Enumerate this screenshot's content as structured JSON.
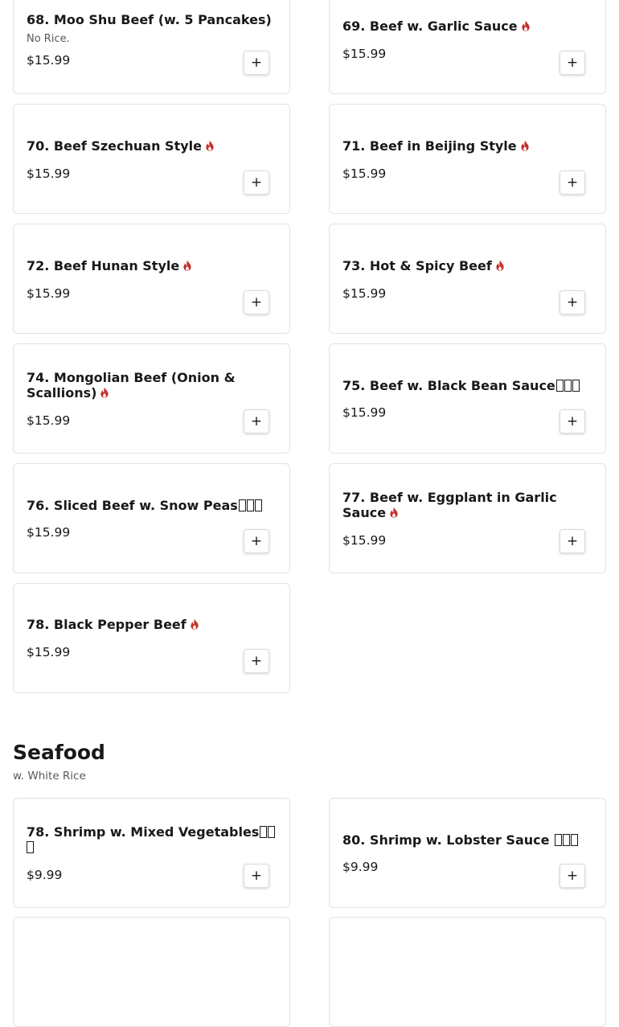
{
  "add_label": "+",
  "colors": {
    "spicy_icon": "#c4302b"
  },
  "icons": {
    "spicy": "flame-icon"
  },
  "beef_items": [
    {
      "title": "68. Moo Shu Beef (w. 5 Pancakes)",
      "description": "No Rice.",
      "price": "$15.99",
      "spicy": false
    },
    {
      "title": "69. Beef w. Garlic Sauce",
      "price": "$15.99",
      "spicy": true
    },
    {
      "title": "70. Beef Szechuan Style",
      "price": "$15.99",
      "spicy": true
    },
    {
      "title": "71. Beef in Beijing Style",
      "price": "$15.99",
      "spicy": true
    },
    {
      "title": "72. Beef Hunan Style",
      "price": "$15.99",
      "spicy": true
    },
    {
      "title": "73. Hot & Spicy Beef",
      "price": "$15.99",
      "spicy": true
    },
    {
      "title": "74. Mongolian Beef (Onion & Scallions)",
      "price": "$15.99",
      "spicy": true
    },
    {
      "title": "75. Beef w. Black Bean Sauce",
      "price": "$15.99",
      "spicy": false
    },
    {
      "title": "76. Sliced Beef w. Snow Peas",
      "price": "$15.99",
      "spicy": false
    },
    {
      "title": "77. Beef w. Eggplant in Garlic Sauce",
      "price": "$15.99",
      "spicy": true
    },
    {
      "title": "78. Black Pepper Beef",
      "price": "$15.99",
      "spicy": true
    }
  ],
  "seafood": {
    "title": "Seafood",
    "subtitle": "w. White Rice",
    "items": [
      {
        "title": "78. Shrimp w. Mixed Vegetables",
        "price": "$9.99",
        "spicy": false
      },
      {
        "title": "80. Shrimp w. Lobster Sauce",
        "price": "$9.99",
        "spicy": false
      }
    ]
  }
}
